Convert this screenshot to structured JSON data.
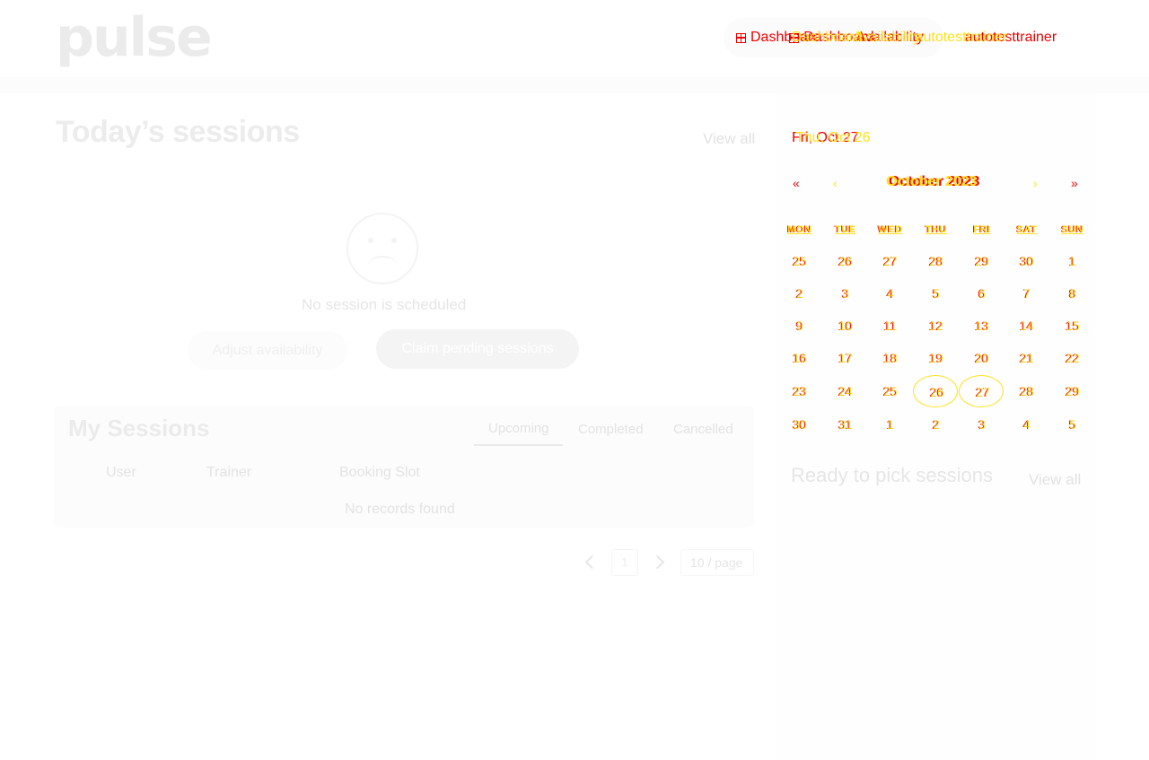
{
  "brand": {
    "logo": "pulse"
  },
  "nav": {
    "items_red": [
      "Dashboard",
      "Availability",
      "autotesttrainer"
    ],
    "items_yellow": [
      "Dashboard",
      "Availability",
      "autotesttrainer"
    ]
  },
  "today": {
    "title": "Today’s sessions",
    "view_all": "View all",
    "empty_message": "No session is scheduled",
    "adjust_button": "Adjust availability",
    "claim_button": "Claim pending sessions"
  },
  "my_sessions": {
    "title": "My Sessions",
    "tabs": [
      "Upcoming",
      "Completed",
      "Cancelled"
    ],
    "active_tab": "Upcoming",
    "columns": [
      "User",
      "Trainer",
      "Booking Slot"
    ],
    "empty": "No records found"
  },
  "pagination": {
    "current_page": "1",
    "page_size": "10 / page"
  },
  "calendar": {
    "selected_date_red": "Fri, Oct 27",
    "selected_date_yellow": "Thu, Oct 26",
    "month_red": "October 2023",
    "month_yellow": "October 2023",
    "nav": {
      "prev_year": "«",
      "prev_month": "‹",
      "next_month": "›",
      "next_year": "»"
    },
    "weekdays": [
      "MON",
      "TUE",
      "WED",
      "THU",
      "FRI",
      "SAT",
      "SUN"
    ],
    "weeks": [
      [
        "25",
        "26",
        "27",
        "28",
        "29",
        "30",
        "1"
      ],
      [
        "2",
        "3",
        "4",
        "5",
        "6",
        "7",
        "8"
      ],
      [
        "9",
        "10",
        "11",
        "12",
        "13",
        "14",
        "15"
      ],
      [
        "16",
        "17",
        "18",
        "19",
        "20",
        "21",
        "22"
      ],
      [
        "23",
        "24",
        "25",
        "26",
        "27",
        "28",
        "29"
      ],
      [
        "30",
        "31",
        "1",
        "2",
        "3",
        "4",
        "5"
      ]
    ],
    "highlighted_days": [
      "26",
      "27"
    ],
    "colors": {
      "red": "#ee0000",
      "yellow": "#ffe11e"
    }
  },
  "ready": {
    "title": "Ready to pick sessions",
    "view_all": "View all"
  }
}
